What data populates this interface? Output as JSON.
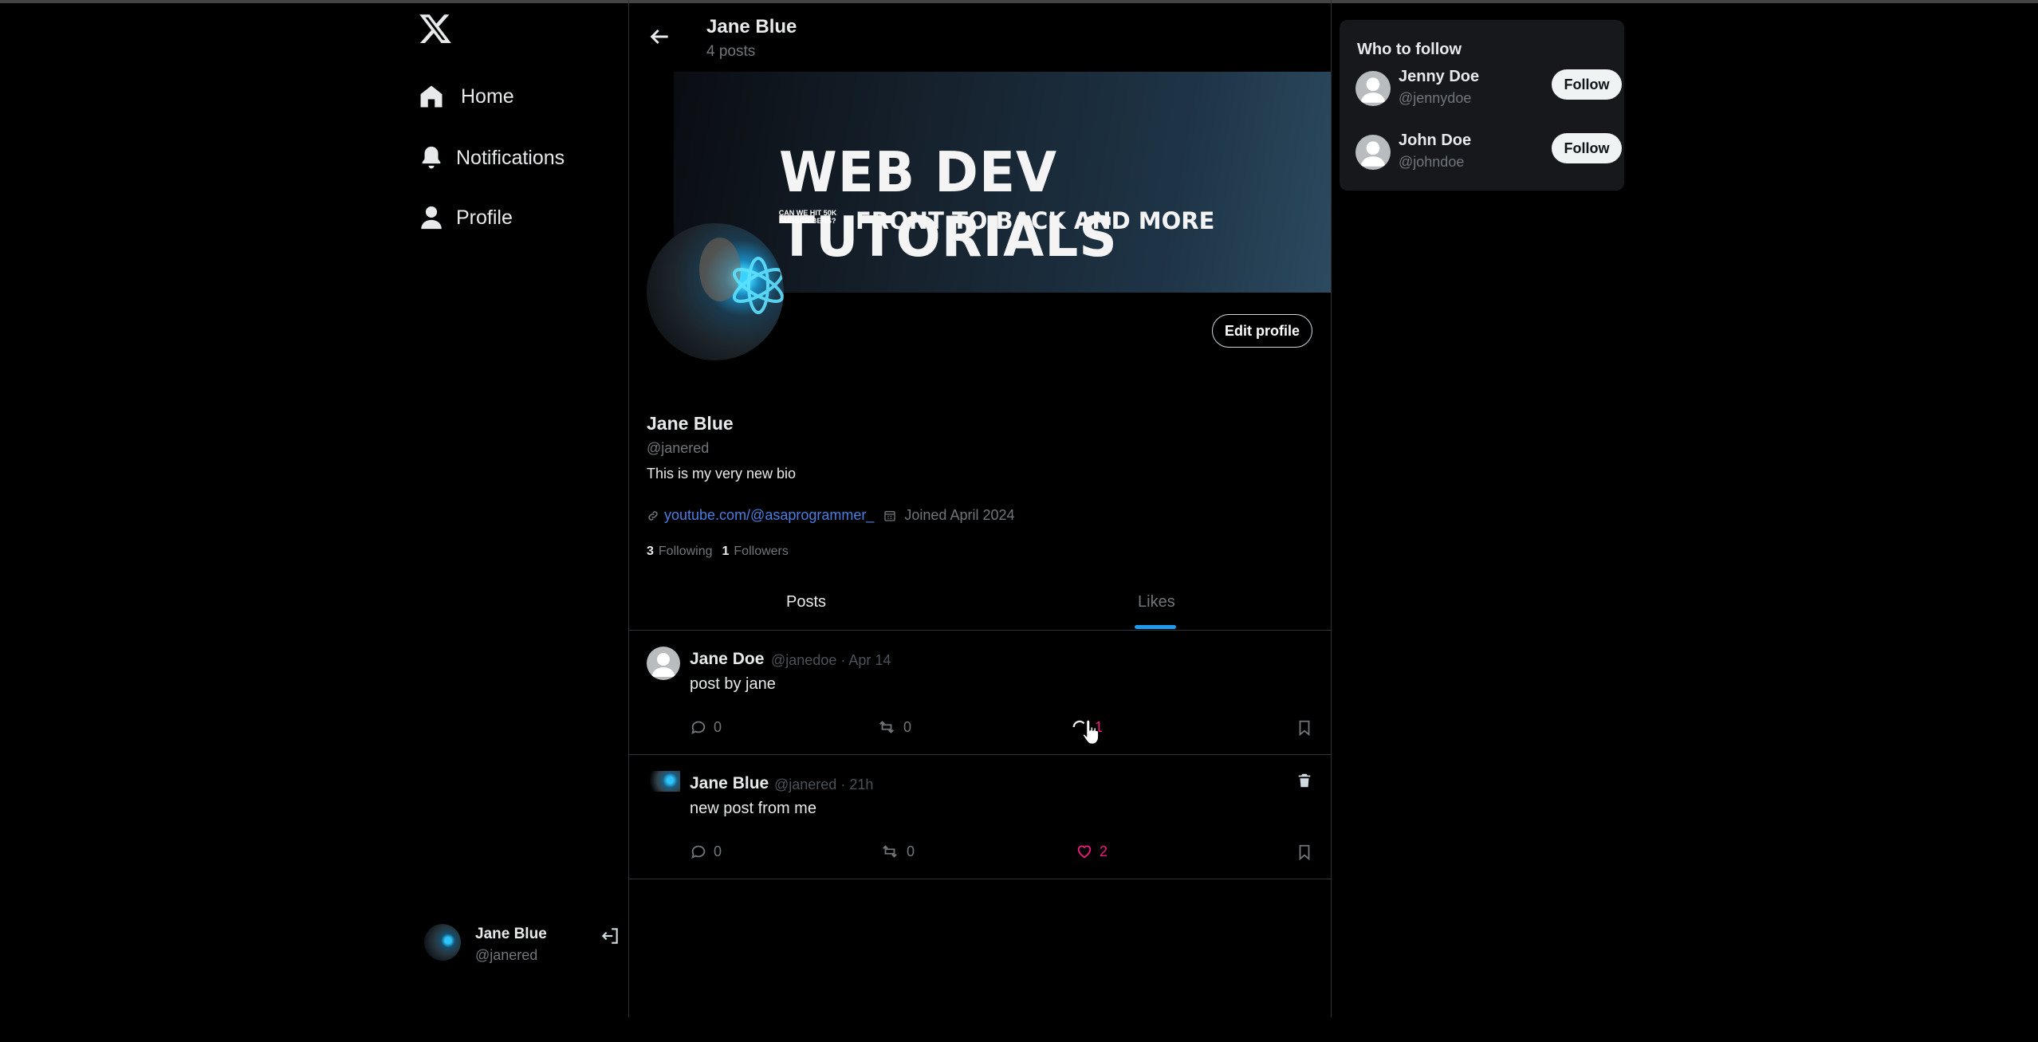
{
  "nav": {
    "logo": "x-logo-icon",
    "items": [
      {
        "label": "Home",
        "icon": "home-icon"
      },
      {
        "label": "Notifications",
        "icon": "bell-icon"
      },
      {
        "label": "Profile",
        "icon": "user-icon"
      }
    ]
  },
  "current_user": {
    "name": "Jane Blue",
    "handle": "@janered"
  },
  "header": {
    "title": "Jane Blue",
    "post_count": "4 posts"
  },
  "banner": {
    "title": "WEB DEV TUTORIALS",
    "subtitle": "FRONT TO BACK AND MORE",
    "small_text": "CAN WE HIT 50K SUBSCRIBERS?"
  },
  "profile": {
    "edit_label": "Edit profile",
    "name": "Jane Blue",
    "handle": "@janered",
    "bio": "This is my very new bio",
    "link": "youtube.com/@asaprogrammer_",
    "joined": "Joined April 2024",
    "following_count": "3",
    "following_label": "Following",
    "followers_count": "1",
    "followers_label": "Followers"
  },
  "tabs": [
    {
      "label": "Posts",
      "active": false
    },
    {
      "label": "Likes",
      "active": true
    }
  ],
  "posts": [
    {
      "name": "Jane Doe",
      "meta": "@janedoe · Apr 14",
      "text": "post by jane",
      "comments": "0",
      "reposts": "0",
      "likes": "1",
      "liked": false
    },
    {
      "name": "Jane Blue",
      "meta": "@janered · 21h",
      "text": "new post from me",
      "comments": "0",
      "reposts": "0",
      "likes": "2",
      "liked": true
    }
  ],
  "who_to_follow": {
    "title": "Who to follow",
    "users": [
      {
        "name": "Jenny Doe",
        "handle": "@jennydoe",
        "button": "Follow"
      },
      {
        "name": "John Doe",
        "handle": "@johndoe",
        "button": "Follow"
      }
    ]
  },
  "colors": {
    "accent": "#1d9bf0",
    "like": "#f91880",
    "link": "#4c7de0",
    "background": "#000000",
    "card": "#16181c"
  }
}
